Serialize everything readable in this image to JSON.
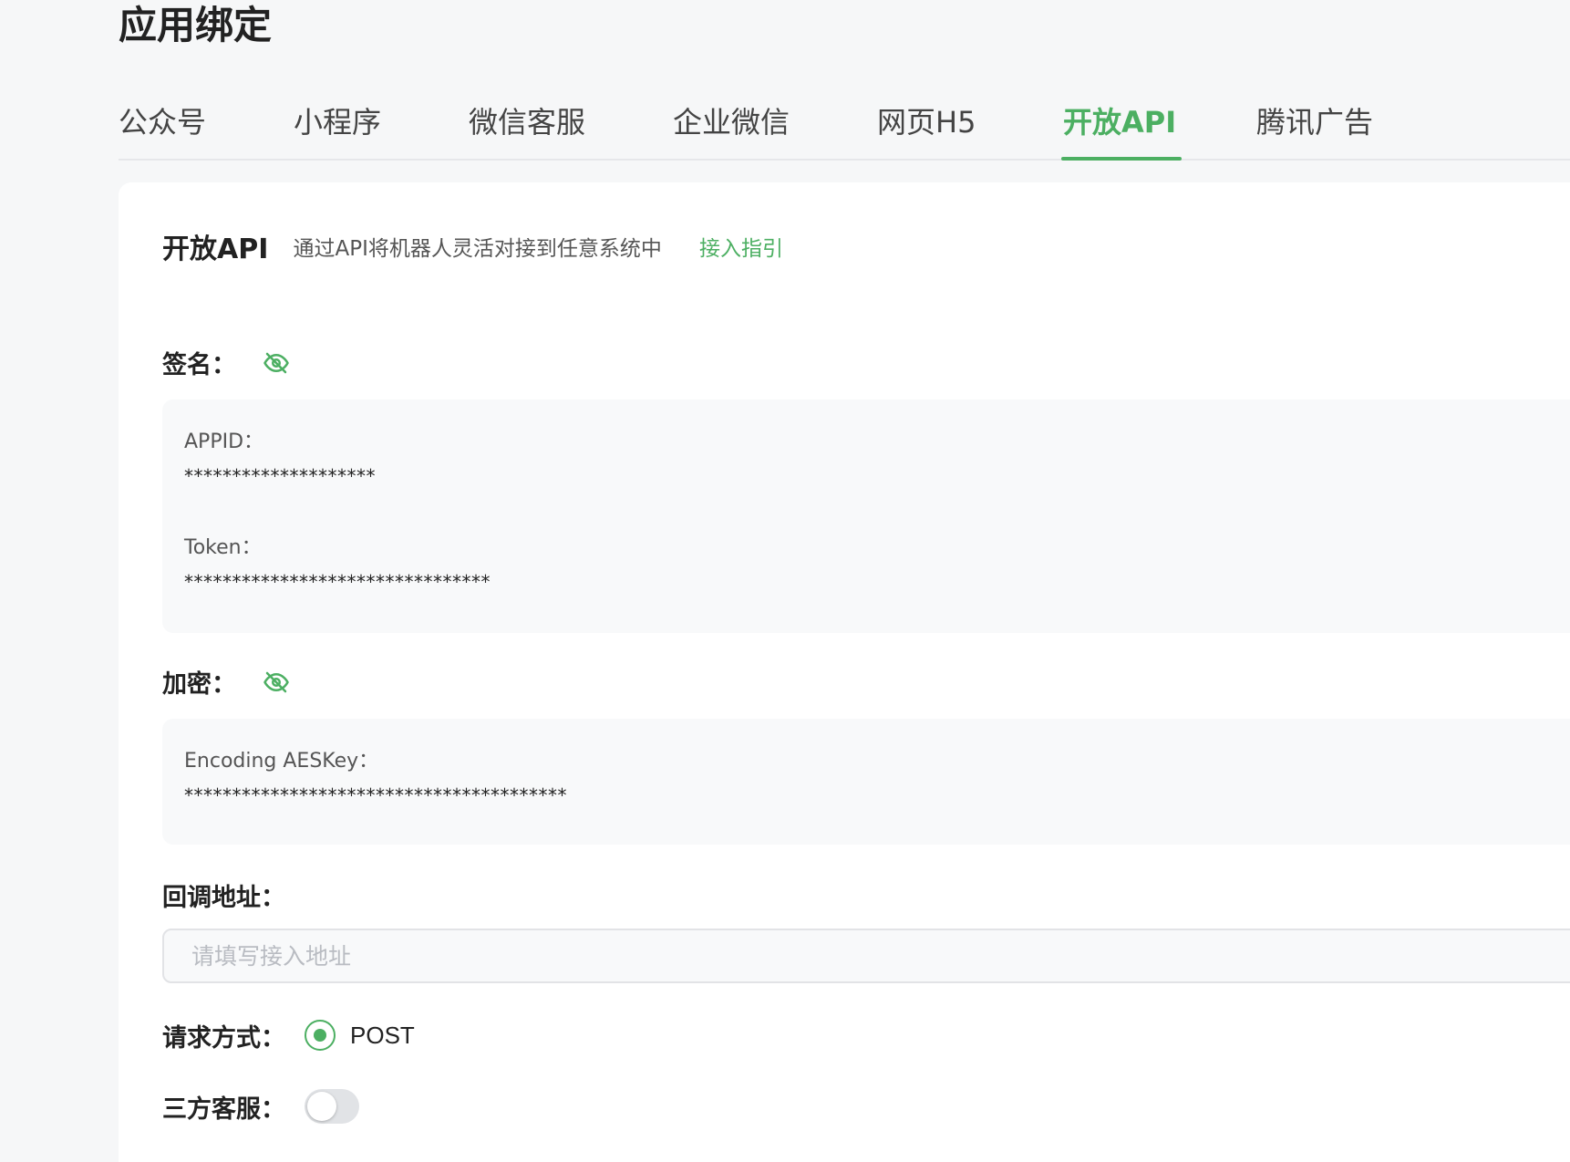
{
  "page": {
    "title": "应用绑定"
  },
  "tabs": [
    {
      "label": "公众号",
      "active": false
    },
    {
      "label": "小程序",
      "active": false
    },
    {
      "label": "微信客服",
      "active": false
    },
    {
      "label": "企业微信",
      "active": false
    },
    {
      "label": "网页H5",
      "active": false
    },
    {
      "label": "开放API",
      "active": true
    },
    {
      "label": "腾讯广告",
      "active": false
    }
  ],
  "card": {
    "title": "开放API",
    "description": "通过API将机器人灵活对接到任意系统中",
    "guide_link": "接入指引"
  },
  "signature": {
    "label": "签名：",
    "icon": "eye-off-icon",
    "appid_label": "APPID：",
    "appid_value": "********************",
    "token_label": "Token：",
    "token_value": "********************************"
  },
  "encryption": {
    "label": "加密：",
    "icon": "eye-off-icon",
    "aeskey_label": "Encoding AESKey：",
    "aeskey_value": "****************************************"
  },
  "callback": {
    "label": "回调地址：",
    "placeholder": "请填写接入地址",
    "value": ""
  },
  "request_method": {
    "label": "请求方式：",
    "option": "POST",
    "selected": true
  },
  "third_party_service": {
    "label": "三方客服：",
    "enabled": false
  },
  "colors": {
    "accent": "#4caf62",
    "background": "#f6f7f8",
    "card": "#ffffff",
    "panel": "#f8f9fa"
  }
}
